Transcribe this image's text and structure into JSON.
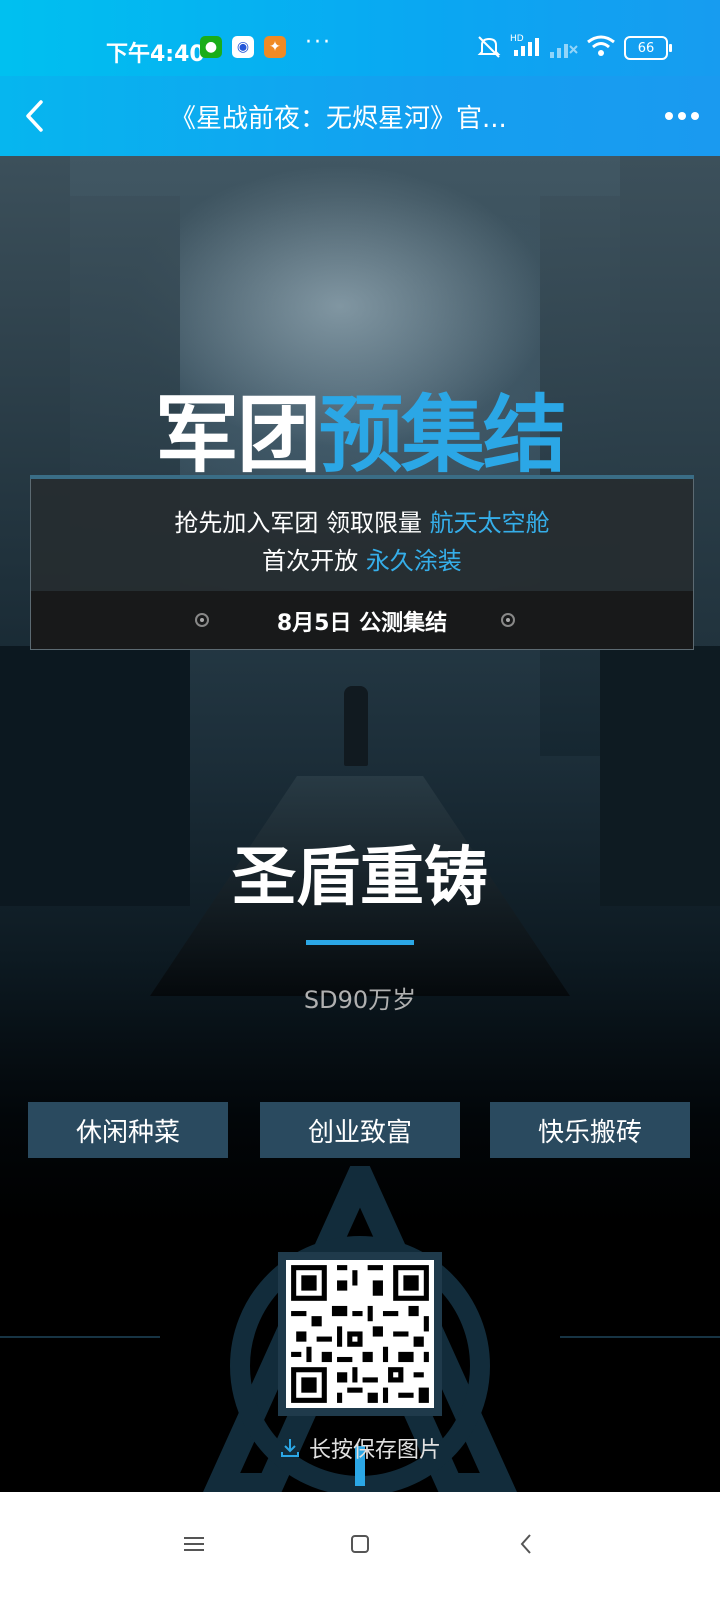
{
  "status": {
    "time": "下午4:40",
    "icons": [
      "wechat-icon",
      "baidu-icon",
      "app-icon",
      "more-notifications"
    ],
    "right_icons": [
      "mute-icon",
      "signal-hd-icon",
      "signal-icon",
      "wifi-icon"
    ],
    "battery": "66",
    "more": "···"
  },
  "header": {
    "title": "《星战前夜：无烬星河》官...",
    "back_icon": "chevron-left-icon",
    "more_icon": "more-dots-icon"
  },
  "hero": {
    "headline_white": "军团",
    "headline_blue": "预集结",
    "line1_prefix": "抢先加入军团 领取限量 ",
    "line1_highlight": "航天太空舱",
    "line2_prefix": "首次开放 ",
    "line2_highlight": "永久涂装",
    "footer": "8月5日 公测集结"
  },
  "main": {
    "title": "圣盾重铸",
    "slogan": "SD90万岁",
    "tags": [
      "休闲种菜",
      "创业致富",
      "快乐搬砖"
    ],
    "save_hint": "长按保存图片"
  },
  "colors": {
    "accent": "#2ba7e6",
    "statusbar": "#0aa7f2",
    "tag_bg": "#2a4a5f"
  },
  "nav": {
    "icons": [
      "menu-icon",
      "home-icon",
      "back-icon"
    ]
  }
}
